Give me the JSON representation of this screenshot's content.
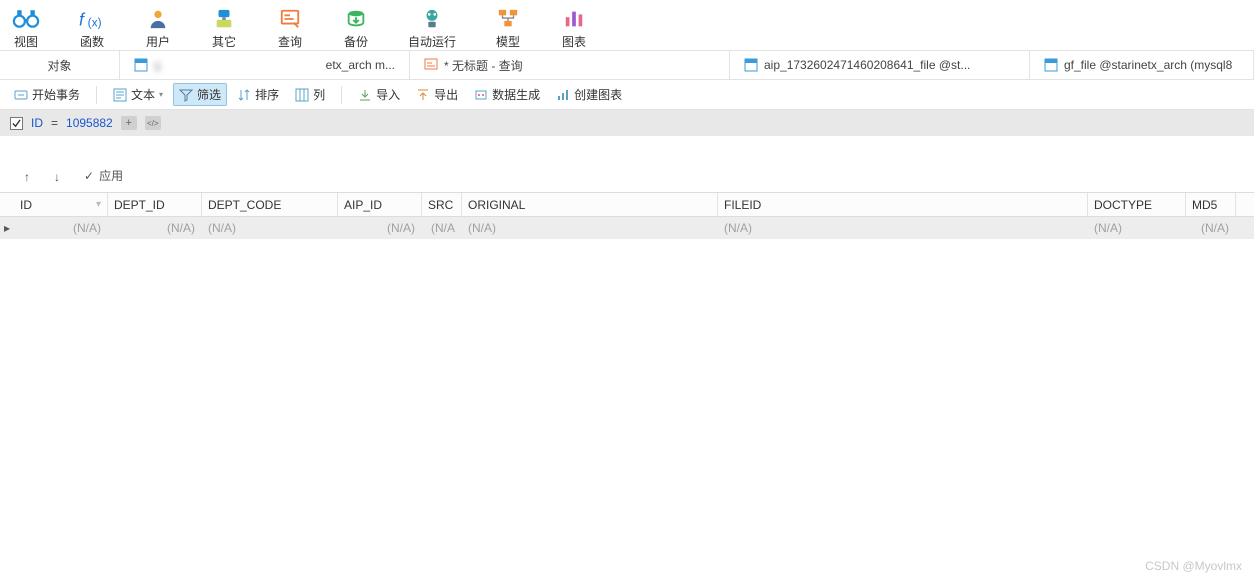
{
  "ribbon": [
    {
      "name": "view",
      "label": "视图",
      "icon": "binoculars",
      "color": "#1e90da"
    },
    {
      "name": "function",
      "label": "函数",
      "icon": "fx",
      "color": "#1e73d6"
    },
    {
      "name": "user",
      "label": "用户",
      "icon": "user",
      "color": "#f4a43a"
    },
    {
      "name": "other",
      "label": "其它",
      "icon": "other",
      "color": "#1e90da"
    },
    {
      "name": "query",
      "label": "查询",
      "icon": "query",
      "color": "#f27b3c"
    },
    {
      "name": "backup",
      "label": "备份",
      "icon": "backup",
      "color": "#3bb55f"
    },
    {
      "name": "autorun",
      "label": "自动运行",
      "icon": "autorun",
      "color": "#3aa6a0"
    },
    {
      "name": "model",
      "label": "模型",
      "icon": "model",
      "color": "#f0933a"
    },
    {
      "name": "chart",
      "label": "图表",
      "icon": "chart",
      "color": "#9b59d0"
    }
  ],
  "tabs": {
    "objects": "对象",
    "t1_blur": "g",
    "t1_suffix": "etx_arch    m...",
    "t2": "* 无标题 - 查询",
    "t3": "aip_1732602471460208641_file @st...",
    "t4": "gf_file @starinetx_arch (mysql8"
  },
  "toolbar": {
    "begin": "开始事务",
    "text": "文本",
    "filter": "筛选",
    "sort": "排序",
    "column": "列",
    "import": "导入",
    "export": "导出",
    "datagen": "数据生成",
    "mkchart": "创建图表"
  },
  "filter": {
    "field": "ID",
    "op": "=",
    "value": "1095882"
  },
  "apply": {
    "up": "↑",
    "down": "↓",
    "check": "✓",
    "label": "应用"
  },
  "grid": {
    "headers": {
      "id": "ID",
      "dept": "DEPT_ID",
      "code": "DEPT_CODE",
      "aip": "AIP_ID",
      "src": "SRC",
      "orig": "ORIGINAL",
      "file": "FILEID",
      "doc": "DOCTYPE",
      "md5": "MD5"
    },
    "na": "(N/A)",
    "na_short": "(N/A"
  },
  "watermark": "CSDN @Myovlmx"
}
